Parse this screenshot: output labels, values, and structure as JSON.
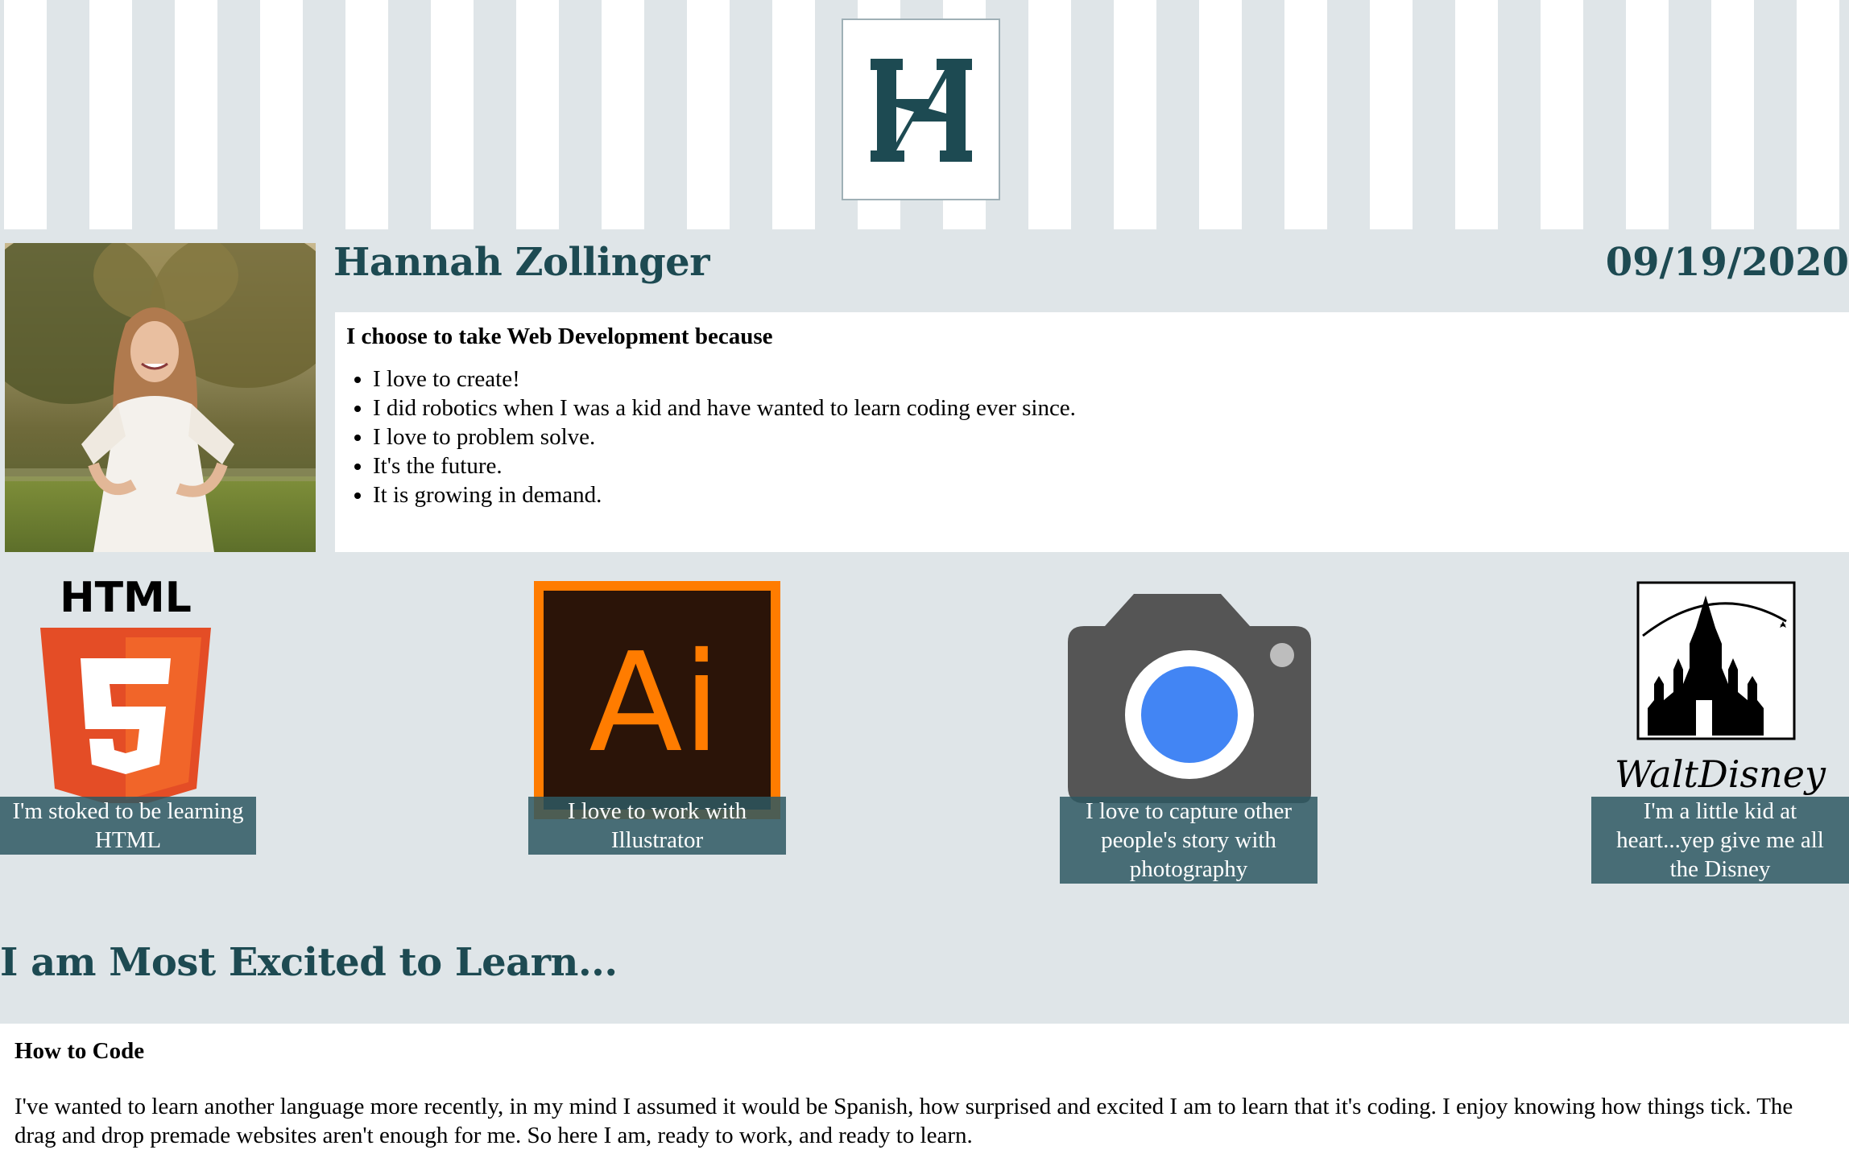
{
  "header": {
    "logo_icon": "h-monogram-logo",
    "brand_color": "#1d4a52"
  },
  "profile": {
    "name": "Hannah Zollinger",
    "date": "09/19/2020",
    "photo_alt": "portrait-photo"
  },
  "why": {
    "title": "I choose to take Web Development because",
    "items": [
      "I love to create!",
      "I did robotics when I was a kid and have wanted to learn coding ever since.",
      "I love to problem solve.",
      "It's the future.",
      "It is growing in demand."
    ]
  },
  "cards": [
    {
      "icon": "html5-icon",
      "caption": "I'm stoked to be learning HTML"
    },
    {
      "icon": "illustrator-icon",
      "caption": "I love to work with Illustrator"
    },
    {
      "icon": "camera-icon",
      "caption": "I love to capture other people's story with photography"
    },
    {
      "icon": "disney-castle-icon",
      "caption": "I'm a little kid at heart...yep give me all the Disney"
    }
  ],
  "excited": {
    "heading": "I am Most Excited to Learn...",
    "subheading": "How to Code",
    "text": "I've wanted to learn another language more recently, in my mind I assumed it would be Spanish, how surprised and excited I am to learn that it's coding. I enjoy knowing how things tick. The drag and drop premade websites aren't enough for me. So here I am, ready to work, and ready to learn."
  },
  "colors": {
    "background": "#dfe5e8",
    "caption_bg": "#2e5862",
    "html5_orange": "#e44d26",
    "ai_orange": "#ff7c00"
  }
}
